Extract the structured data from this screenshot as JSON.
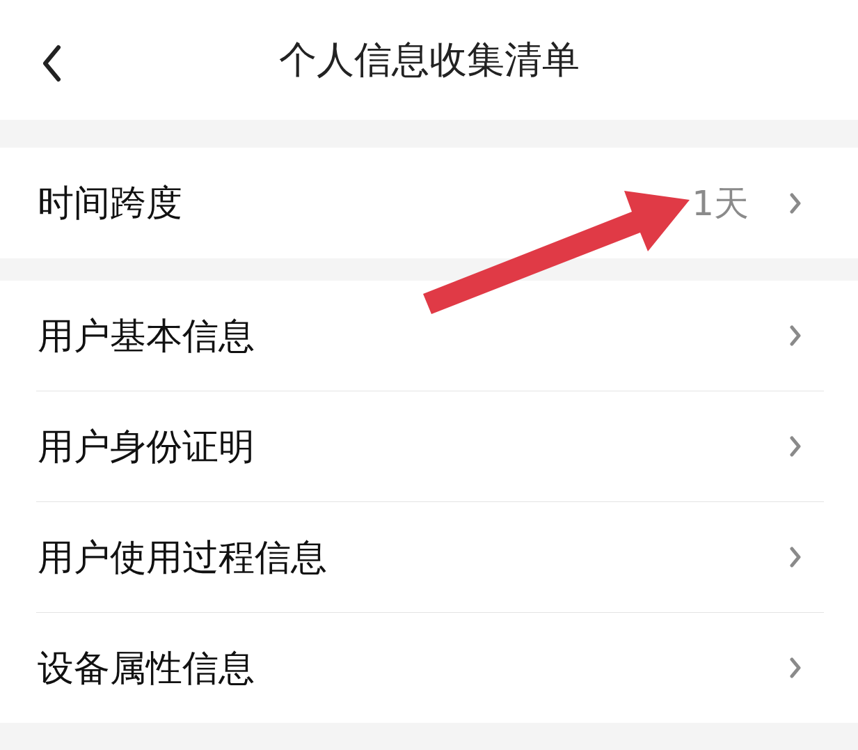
{
  "header": {
    "title": "个人信息收集清单"
  },
  "sections": [
    {
      "items": [
        {
          "label": "时间跨度",
          "value": "1天"
        }
      ]
    },
    {
      "items": [
        {
          "label": "用户基本信息"
        },
        {
          "label": "用户身份证明"
        },
        {
          "label": "用户使用过程信息"
        },
        {
          "label": "设备属性信息"
        }
      ]
    }
  ],
  "annotations": [
    {
      "kind": "arrow"
    }
  ]
}
